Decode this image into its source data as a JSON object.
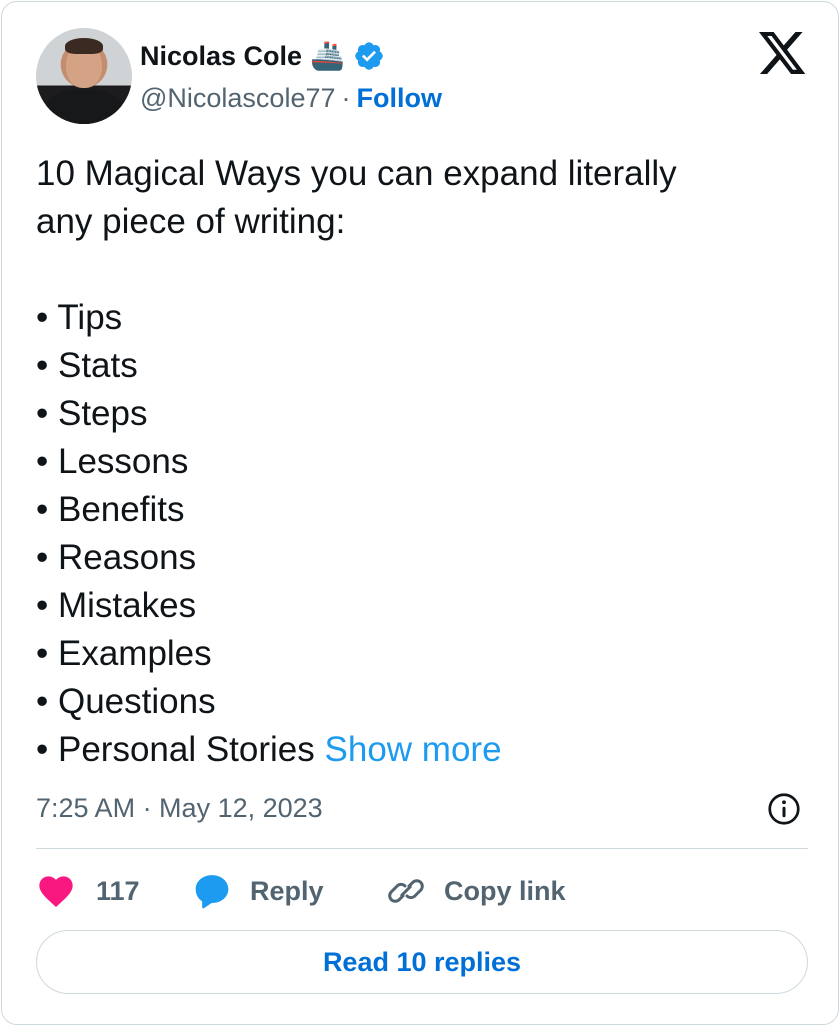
{
  "author": {
    "name": "Nicolas Cole",
    "emoji": "🚢",
    "handle": "@Nicolascole77",
    "separator": "·",
    "follow_label": "Follow"
  },
  "tweet": {
    "intro_line_1": "10 Magical Ways you can expand literally",
    "intro_line_2": "any piece of writing:",
    "bullets": [
      "• Tips",
      "• Stats",
      "• Steps",
      "• Lessons",
      "• Benefits",
      "• Reasons",
      "• Mistakes",
      "• Examples",
      "• Questions",
      "• Personal Stories"
    ],
    "show_more_label": "Show more"
  },
  "meta": {
    "timestamp": "7:25 AM · May 12, 2023"
  },
  "actions": {
    "like_count": "117",
    "reply_label": "Reply",
    "copy_link_label": "Copy link"
  },
  "read_replies_label": "Read 10 replies",
  "colors": {
    "accent": "#1d9bf0",
    "link_bold": "#006fd6",
    "heart": "#f91880",
    "muted": "#536471",
    "border": "#cfd9de"
  },
  "icons": {
    "verified": "verified-badge-icon",
    "platform": "x-logo-icon",
    "info": "info-icon",
    "like": "heart-icon",
    "reply": "speech-bubble-icon",
    "copy": "link-icon"
  }
}
